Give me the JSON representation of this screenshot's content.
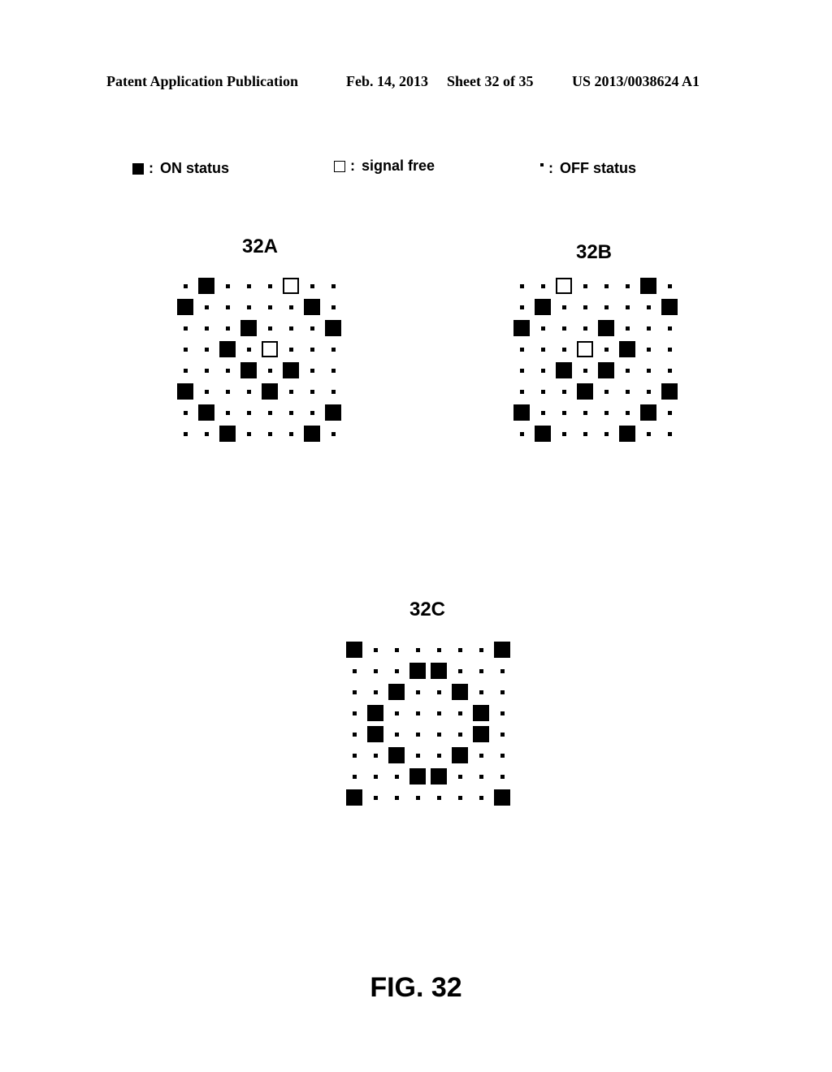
{
  "header": {
    "publication": "Patent Application Publication",
    "date": "Feb. 14, 2013",
    "sheet": "Sheet 32 of 35",
    "patent_number": "US 2013/0038624 A1"
  },
  "legend": [
    {
      "symbol": "on",
      "icon": "filled-square-icon",
      "label": "ON status"
    },
    {
      "symbol": "free",
      "icon": "empty-square-icon",
      "label": "signal free"
    },
    {
      "symbol": "off",
      "icon": "small-dot-icon",
      "label": "OFF status"
    }
  ],
  "legend_separator": ":",
  "grids": [
    {
      "title": "32A",
      "rows": [
        ". X . . . O . .",
        "X . . . . . X .",
        ". . . X . . . X",
        ". . X . O . . .",
        ". . . X . X . .",
        "X . . . X . . .",
        ". X . . . . . X",
        ". . X . . . X ."
      ]
    },
    {
      "title": "32B",
      "rows": [
        ". . O . . . X .",
        ". X . . . . . X",
        "X . . . X . . .",
        ". . . O . X . .",
        ". . X . X . . .",
        ". . . X . . . X",
        "X . . . . . X .",
        ". X . . . X . ."
      ]
    },
    {
      "title": "32C",
      "rows": [
        "X . . . . . . X",
        ". . . X X . . .",
        ". . X . . X . .",
        ". X . . . . X .",
        ". X . . . . X .",
        ". . X . . X . .",
        ". . . X X . . .",
        "X . . . . . . X"
      ]
    }
  ],
  "grid_key": {
    "X": "ON status",
    "O": "signal free",
    ".": "OFF status"
  },
  "figure_label": "FIG. 32"
}
